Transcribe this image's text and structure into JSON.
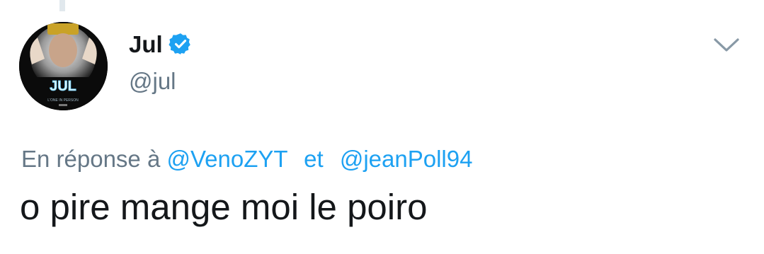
{
  "tweet": {
    "author": {
      "display_name": "Jul",
      "username": "@jul",
      "verified": true,
      "avatar_text": "JUL",
      "avatar_subtitle": "L'ONE IN PERSON"
    },
    "reply_context": {
      "prefix": "En réponse à",
      "mention_1": "@VenoZYT",
      "separator": "et",
      "mention_2": "@jeanPoll94"
    },
    "text": "o pire mange moi le poiro"
  },
  "icons": {
    "verified": "verified-badge-icon",
    "menu": "chevron-down-icon"
  },
  "colors": {
    "accent": "#1da1f2",
    "text_primary": "#14171a",
    "text_secondary": "#657786",
    "thread_line": "#e1e8ed"
  }
}
